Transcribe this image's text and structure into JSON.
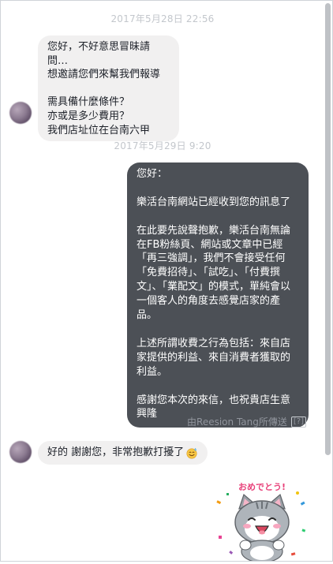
{
  "timestamps": [
    "2017年5月28日 22:56",
    "2017年5月29日 9:20"
  ],
  "messages": [
    {
      "direction": "incoming",
      "text": "您好，不好意思冒昧請問…\n想邀請您們來幫我們報導\n\n需具備什麼條件？\n亦或是多少費用？\n我們店址位在台南六甲"
    },
    {
      "direction": "outgoing",
      "text": "您好：\n\n樂活台南網站已經收到您的訊息了\n\n在此要先說聲抱歉，樂活台南無論在FB粉絲頁、網站或文章中已經「再三強調」，我們不會接受任何「免費招待」、「試吃」、「付費撰文」、「業配文」的模式，單純會以一個客人的角度去感覺店家的產品。\n\n上述所謂收費之行為包括：來自店家提供的利益、來自消費者獲取的利益。\n\n感謝您本次的來信，也祝貴店生意興隆"
    },
    {
      "direction": "incoming",
      "text": "好的 謝謝您，非常抱歉打擾了",
      "emoji": "sweat-smile-emoji"
    }
  ],
  "sent_by": {
    "label": "由Reesion Tang所傳送",
    "help": "[?]"
  },
  "sticker": {
    "icon": "cat-congratulations-sticker",
    "caption": "おめでとう!"
  },
  "colors": {
    "incoming_bubble": "#f1f0f0",
    "outgoing_bubble": "#4c5056",
    "timestamp_text": "#c3c7cc",
    "scrollbar": "#bfc2c6"
  }
}
